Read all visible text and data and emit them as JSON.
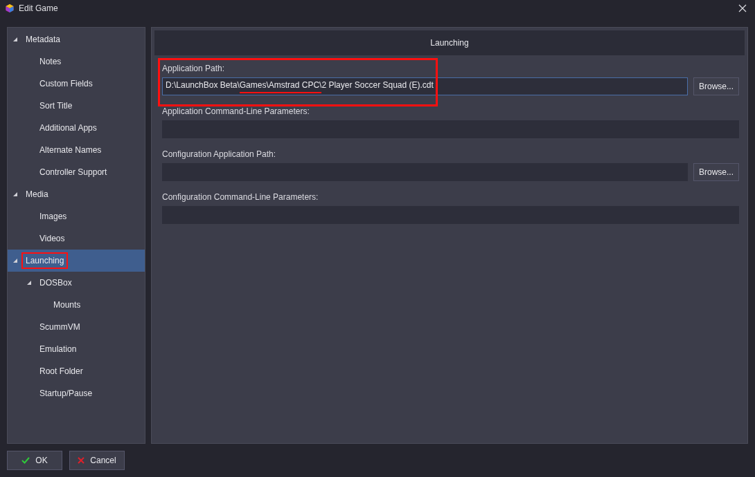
{
  "window": {
    "title": "Edit Game"
  },
  "tree": [
    {
      "label": "Metadata",
      "expanded": true,
      "selected": false,
      "annotated": false,
      "children": [
        {
          "label": "Notes",
          "selected": false,
          "annotated": false
        },
        {
          "label": "Custom Fields",
          "selected": false,
          "annotated": false
        },
        {
          "label": "Sort Title",
          "selected": false,
          "annotated": false
        },
        {
          "label": "Additional Apps",
          "selected": false,
          "annotated": false
        },
        {
          "label": "Alternate Names",
          "selected": false,
          "annotated": false
        },
        {
          "label": "Controller Support",
          "selected": false,
          "annotated": false
        }
      ]
    },
    {
      "label": "Media",
      "expanded": true,
      "selected": false,
      "annotated": false,
      "children": [
        {
          "label": "Images",
          "selected": false,
          "annotated": false
        },
        {
          "label": "Videos",
          "selected": false,
          "annotated": false
        }
      ]
    },
    {
      "label": "Launching",
      "expanded": true,
      "selected": true,
      "annotated": true,
      "children": [
        {
          "label": "DOSBox",
          "expanded": true,
          "selected": false,
          "annotated": false,
          "children": [
            {
              "label": "Mounts",
              "selected": false,
              "annotated": false
            }
          ]
        },
        {
          "label": "ScummVM",
          "selected": false,
          "annotated": false
        },
        {
          "label": "Emulation",
          "selected": false,
          "annotated": false
        },
        {
          "label": "Root Folder",
          "selected": false,
          "annotated": false
        },
        {
          "label": "Startup/Pause",
          "selected": false,
          "annotated": false
        }
      ]
    }
  ],
  "section": {
    "title": "Launching"
  },
  "fields": [
    {
      "label": "Application Path:",
      "focused": true,
      "annotated": true,
      "value": [
        {
          "text": "D:\\LaunchBox Beta\\",
          "underlined": false
        },
        {
          "text": "Games\\Amstrad CPC\\",
          "underlined": true
        },
        {
          "text": "2 Player Soccer Squad (E).cdt",
          "underlined": false
        }
      ],
      "button": "Browse..."
    },
    {
      "label": "Application Command-Line Parameters:",
      "focused": false,
      "annotated": false
    },
    {
      "label": "Configuration Application Path:",
      "focused": false,
      "annotated": false,
      "button": "Browse..."
    },
    {
      "label": "Configuration Command-Line Parameters:",
      "focused": false,
      "annotated": false
    }
  ],
  "buttons": [
    {
      "label": "OK",
      "kind": "ok"
    },
    {
      "label": "Cancel",
      "kind": "cancel"
    }
  ]
}
